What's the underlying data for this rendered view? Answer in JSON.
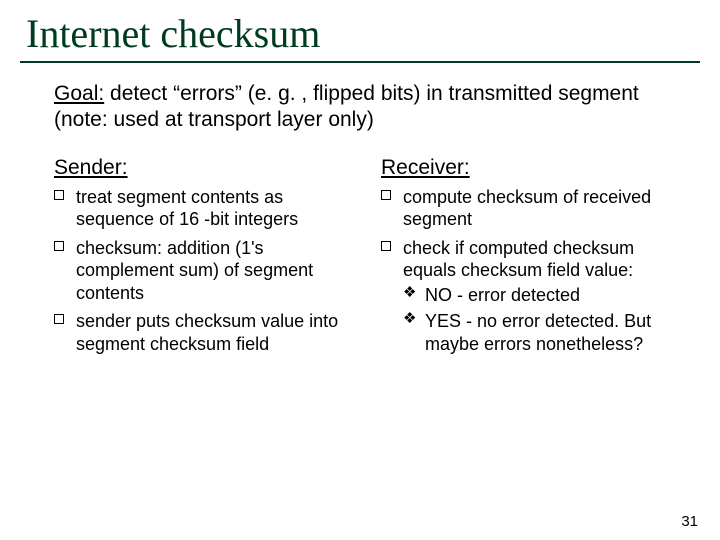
{
  "title": "Internet checksum",
  "goal": {
    "label": "Goal:",
    "text": " detect “errors” (e. g. , flipped bits) in transmitted segment (note: used at transport layer only)"
  },
  "left": {
    "heading": "Sender:",
    "items": [
      "treat segment contents as sequence of 16 -bit integers",
      "checksum: addition (1's complement sum) of segment contents",
      "sender puts checksum value into segment checksum field"
    ]
  },
  "right": {
    "heading": "Receiver:",
    "items": [
      {
        "text": "compute checksum of received segment"
      },
      {
        "text": "check if computed checksum equals checksum field value:",
        "sub": [
          "NO - error detected",
          "YES - no error detected. But maybe errors nonetheless?"
        ]
      }
    ]
  },
  "page": "31"
}
